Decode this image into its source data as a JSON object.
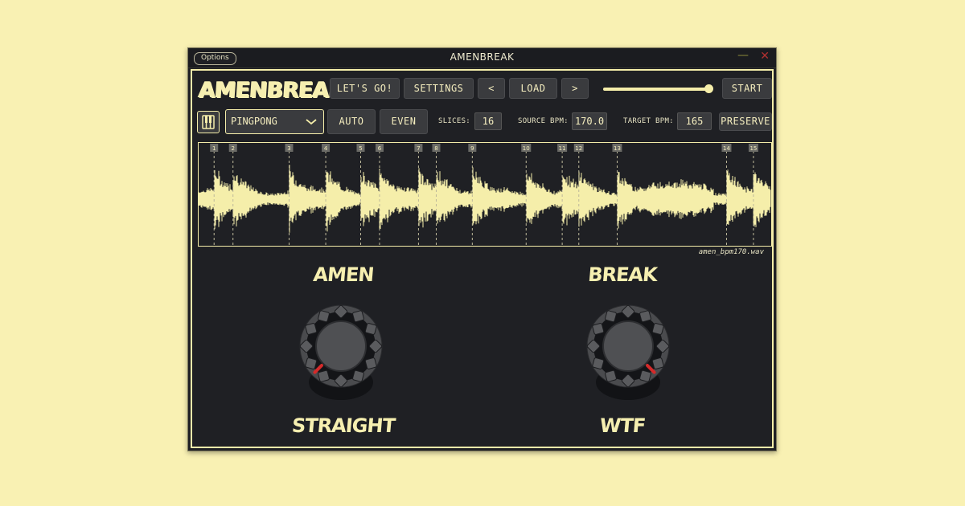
{
  "window": {
    "title": "AMENBREAK",
    "options_label": "Options",
    "minimize_glyph": "—",
    "close_glyph": "✕"
  },
  "toolbar": {
    "logo": "AMENBREAK",
    "lets_go": "LET'S GO!",
    "settings": "SETTINGS",
    "prev": "<",
    "load": "LOAD",
    "next": ">",
    "volume_fraction": 0.97,
    "start": "START"
  },
  "controls": {
    "mode": "PINGPONG",
    "auto": "AUTO",
    "even": "EVEN",
    "slices_label": "SLICES:",
    "slices": "16",
    "source_bpm_label": "SOURCE BPM:",
    "source_bpm": "170.0",
    "target_bpm_label": "TARGET BPM:",
    "target_bpm": "165",
    "preserve": "PRESERVE"
  },
  "waveform": {
    "filename": "amen_bpm170.wav",
    "markers": [
      "1",
      "2",
      "3",
      "4",
      "5",
      "6",
      "7",
      "8",
      "9",
      "10",
      "11",
      "12",
      "13",
      "14",
      "15"
    ],
    "marker_fractions": [
      0.027,
      0.06,
      0.158,
      0.222,
      0.283,
      0.316,
      0.384,
      0.415,
      0.478,
      0.572,
      0.635,
      0.664,
      0.731,
      0.922,
      0.969
    ]
  },
  "knobs": {
    "left": {
      "top_label": "AMEN",
      "bottom_label": "STRAIGHT",
      "value_fraction": 0.0
    },
    "right": {
      "top_label": "BREAK",
      "bottom_label": "WTF",
      "value_fraction": 1.0
    }
  },
  "colors": {
    "accent": "#f5eeaa",
    "background": "#1f2024",
    "page": "#f9f1b3",
    "button": "#3a3b3e",
    "indicator": "#d42a2a"
  }
}
